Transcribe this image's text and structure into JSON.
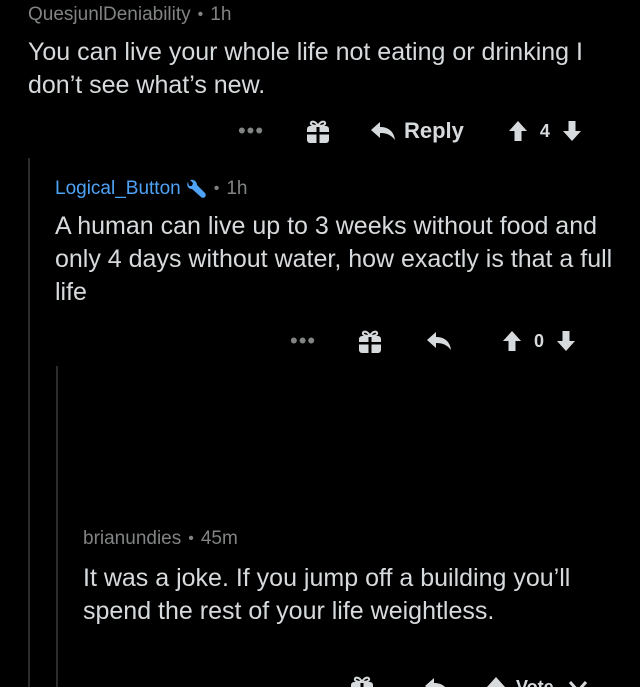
{
  "comments": [
    {
      "username": "QuesjunlDeniability",
      "separator": "•",
      "time": "1h",
      "text": "You can live your whole life not eating or drinking I don’t see what’s new.",
      "reply_label": "Reply",
      "score": "4"
    },
    {
      "username": "Logical_Button",
      "separator": "•",
      "time": "1h",
      "text": "A human can live up to 3 weeks without food and only 4 days without water, how exactly is that a full life",
      "score": "0"
    },
    {
      "username": "brianundies",
      "separator": "•",
      "time": "45m",
      "text": "It was a joke. If you jump off a building you’ll spend the rest of your life weightless."
    }
  ],
  "bottom_bar": {
    "vote_label": "Vote"
  },
  "colors": {
    "background": "#000000",
    "meta": "#818384",
    "text": "#d7dadc",
    "username_link": "#4fa3f7",
    "thread_line": "#2c2c2e"
  },
  "icons": [
    "more-icon",
    "award-icon",
    "reply-icon",
    "upvote-icon",
    "downvote-icon",
    "wrench-icon",
    "collapse-icon"
  ]
}
